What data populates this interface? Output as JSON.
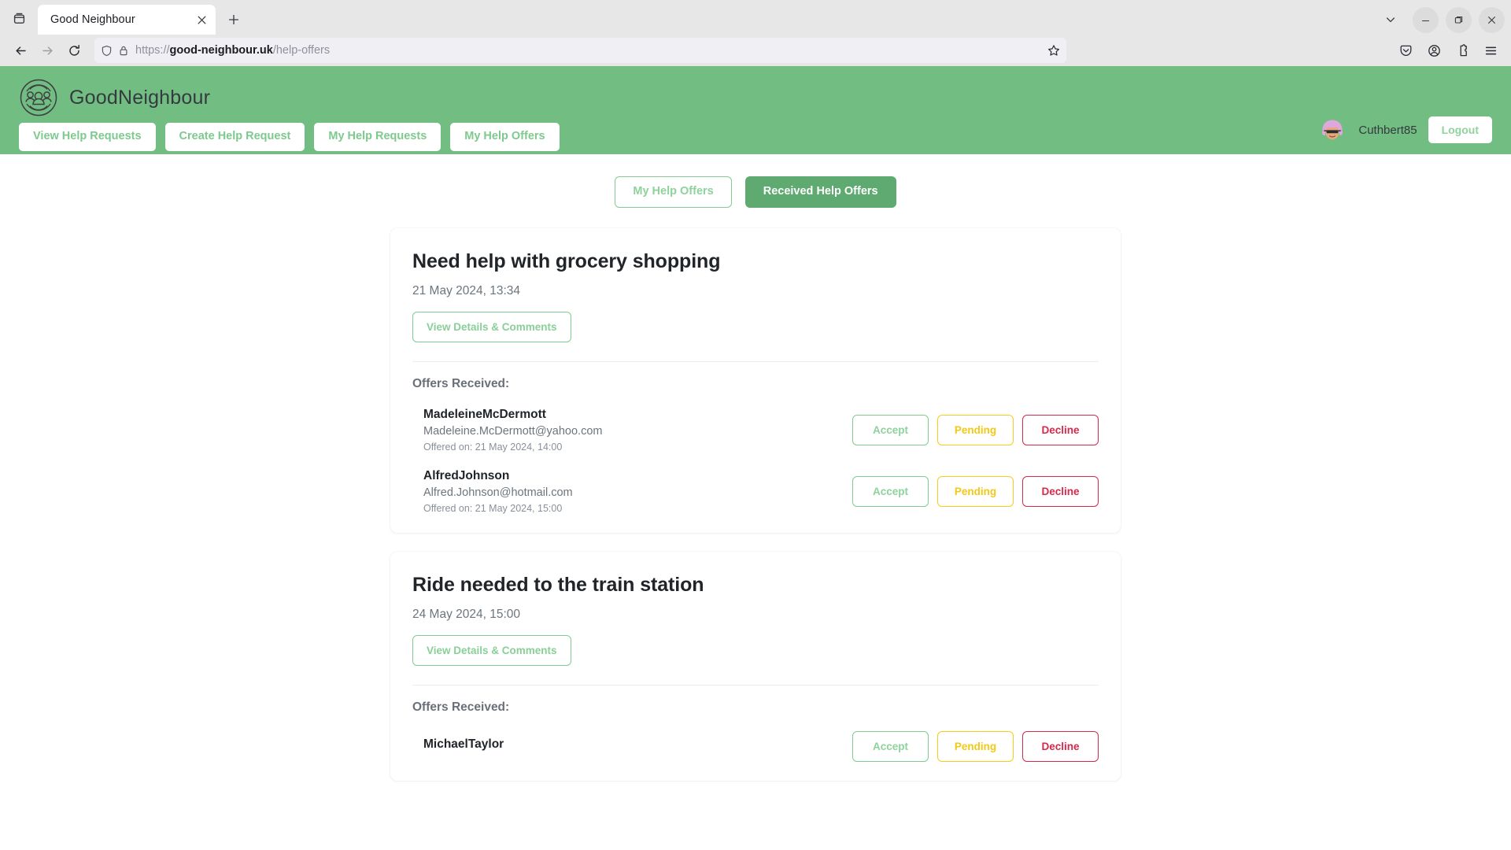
{
  "browser": {
    "tab_title": "Good Neighbour",
    "url_protocol": "https://",
    "url_domain": "good-neighbour.uk",
    "url_path": "/help-offers",
    "url_full": "https://good-neighbour.uk/help-offers"
  },
  "header": {
    "brand_name": "GoodNeighbour",
    "brand_color": "#72bd81",
    "nav": [
      {
        "label": "View Help Requests"
      },
      {
        "label": "Create Help Request"
      },
      {
        "label": "My Help Requests"
      },
      {
        "label": "My Help Offers"
      }
    ],
    "username": "Cuthbert85",
    "logout_label": "Logout"
  },
  "toggle": {
    "my_offers_label": "My Help Offers",
    "received_offers_label": "Received Help Offers",
    "active": "Received Help Offers",
    "active_bg": "#5faa70"
  },
  "labels": {
    "offers_received": "Offers Received:",
    "details_button": "View Details & Comments",
    "accept": "Accept",
    "pending": "Pending",
    "decline": "Decline",
    "offered_on_prefix": "Offered on: "
  },
  "status_colors": {
    "accept": "#8ed29c",
    "pending": "#f4c816",
    "decline": "#d6294c"
  },
  "cards": [
    {
      "title": "Need help with grocery shopping",
      "date": "21 May 2024, 13:34",
      "offers": [
        {
          "name": "MadeleineMcDermott",
          "email": "Madeleine.McDermott@yahoo.com",
          "offered_on": "Offered on: 21 May 2024, 14:00"
        },
        {
          "name": "AlfredJohnson",
          "email": "Alfred.Johnson@hotmail.com",
          "offered_on": "Offered on: 21 May 2024, 15:00"
        }
      ]
    },
    {
      "title": "Ride needed to the train station",
      "date": "24 May 2024, 15:00",
      "offers": [
        {
          "name": "MichaelTaylor",
          "email": "",
          "offered_on": ""
        }
      ]
    }
  ]
}
